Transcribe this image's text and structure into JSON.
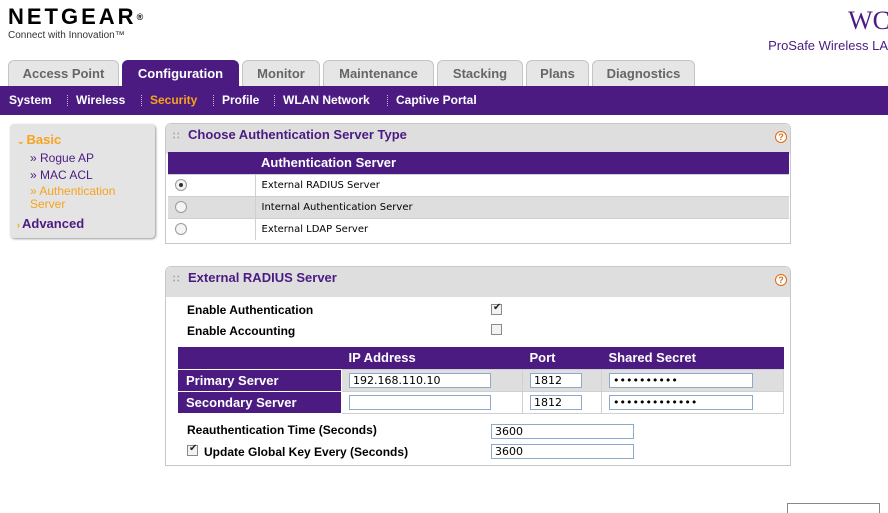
{
  "brand": {
    "logo": "NETGEAR",
    "logo_reg": "®",
    "tagline": "Connect with Innovation™"
  },
  "product": {
    "model": "WC",
    "line": "ProSafe Wireless LA"
  },
  "tabs": [
    {
      "label": "Access Point",
      "active": false
    },
    {
      "label": "Configuration",
      "active": true
    },
    {
      "label": "Monitor",
      "active": false
    },
    {
      "label": "Maintenance",
      "active": false
    },
    {
      "label": "Stacking",
      "active": false
    },
    {
      "label": "Plans",
      "active": false
    },
    {
      "label": "Diagnostics",
      "active": false
    }
  ],
  "subnav": [
    {
      "label": "System",
      "active": false
    },
    {
      "label": "Wireless",
      "active": false
    },
    {
      "label": "Security",
      "active": true
    },
    {
      "label": "Profile",
      "active": false
    },
    {
      "label": "WLAN Network",
      "active": false
    },
    {
      "label": "Captive Portal",
      "active": false
    }
  ],
  "sidebar": {
    "basic_label": "Basic",
    "items": [
      {
        "label": "» Rogue AP",
        "active": false
      },
      {
        "label": "» MAC ACL",
        "active": false
      },
      {
        "label": "» Authentication Server",
        "active": true
      }
    ],
    "advanced_label": "Advanced"
  },
  "auth_panel": {
    "title": "Choose Authentication Server Type",
    "help_glyph": "?",
    "column_header": "Authentication Server",
    "options": [
      {
        "label": "External RADIUS Server",
        "selected": true
      },
      {
        "label": "Internal Authentication Server",
        "selected": false
      },
      {
        "label": "External LDAP Server",
        "selected": false
      }
    ]
  },
  "radius_panel": {
    "title": "External RADIUS Server",
    "help_glyph": "?",
    "enable_auth_label": "Enable Authentication",
    "enable_auth_checked": true,
    "enable_acct_label": "Enable Accounting",
    "enable_acct_checked": false,
    "columns": [
      "",
      "IP Address",
      "Port",
      "Shared Secret"
    ],
    "servers": [
      {
        "label": "Primary Server",
        "ip": "192.168.110.10",
        "port": "1812",
        "secret": "••••••••••"
      },
      {
        "label": "Secondary Server",
        "ip": "",
        "port": "1812",
        "secret": "•••••••••••••"
      }
    ],
    "reauth_label": "Reauthentication Time (Seconds)",
    "reauth_value": "3600",
    "update_key_label": "Update Global Key Every (Seconds)",
    "update_key_checked": true,
    "update_key_value": "3600"
  }
}
